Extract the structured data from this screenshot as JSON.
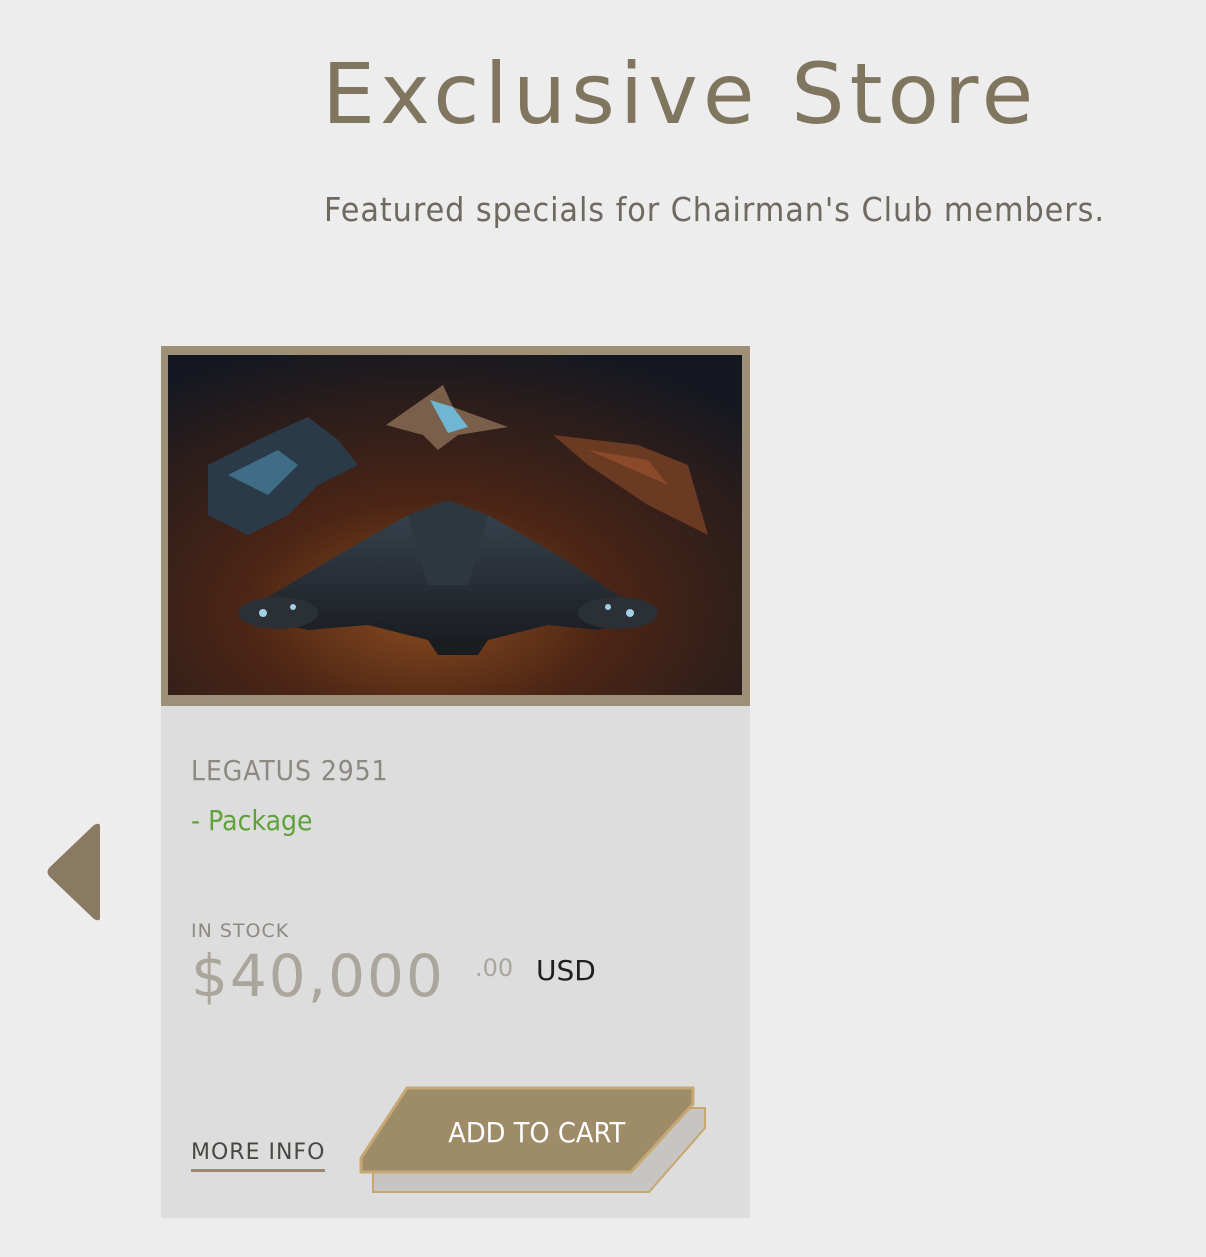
{
  "header": {
    "title": "Exclusive Store",
    "subtitle": "Featured specials for Chairman's Club members."
  },
  "carousel": {
    "prev_icon": "caret-left-icon"
  },
  "product": {
    "image_icon": "spaceship-fleet-image",
    "name": "LEGATUS 2951",
    "type": "- Package",
    "stock_status": "IN STOCK",
    "price_main": "$40,000",
    "price_cents": ".00",
    "currency": "USD",
    "more_info_label": "MORE INFO",
    "add_to_cart_label": "ADD TO CART"
  },
  "colors": {
    "background": "#ededed",
    "accent_gold": "#9e8b68",
    "package_green": "#5fa23a",
    "card": "#dddddd"
  }
}
